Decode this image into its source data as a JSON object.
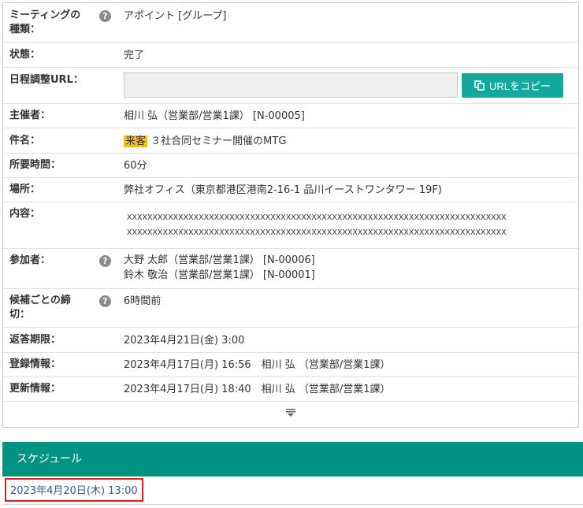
{
  "meeting": {
    "rows": [
      {
        "label_line1": "ミーティングの",
        "label_line2": "種類：",
        "value": "アポイント [グループ]"
      },
      {
        "label": "状態：",
        "value": "完了"
      },
      {
        "label": "日程調整URL：",
        "url_value": "",
        "copy_button": "URLをコピー"
      },
      {
        "label": "主催者：",
        "value": "相川 弘（営業部/営業1課） [N-00005]"
      },
      {
        "label": "件名：",
        "tag": "来客",
        "value": "３社合同セミナー開催のMTG"
      },
      {
        "label": "所要時間：",
        "value": "60分"
      },
      {
        "label": "場所：",
        "value": "弊社オフィス（東京都港区港南2-16-1 品川イーストワンタワー 19F)"
      },
      {
        "label": "内容：",
        "value_line1": "XXXXXXXXXXXXXXXXXXXXXXXXXXXXXXXXXXXXXXXXXXXXXXXXXXXXXXXXXXXXXXXXXXXXXXXXXX",
        "value_line2": "XXXXXXXXXXXXXXXXXXXXXXXXXXXXXXXXXXXXXXXXXXXXXXXXXXXXXXXXXXXXXXXXXXXXXXXXXX"
      },
      {
        "label": "参加者：",
        "value_line1": "大野 太郎（営業部/営業1課） [N-00006]",
        "value_line2": "鈴木 敬治（営業部/営業1課） [N-00001]"
      },
      {
        "label_line1": "候補ごとの締",
        "label_line2": "切：",
        "value": "6時間前"
      },
      {
        "label": "返答期限：",
        "value": "2023年4月21日(金) 3:00"
      },
      {
        "label": "登録情報：",
        "value": "2023年4月17日(月) 16:56　相川 弘 （営業部/営業1課）"
      },
      {
        "label": "更新情報：",
        "value": "2023年4月17日(月) 18:40　相川 弘 （営業部/営業1課）"
      }
    ],
    "help_glyph": "?"
  },
  "schedule": {
    "title": "スケジュール",
    "entry": "2023年4月20日(木) 13:00"
  },
  "colors": {
    "accent": "#13a89e",
    "header": "#009384",
    "tag": "#f7c31b",
    "link": "#2f5c9c",
    "highlight": "#d92020"
  },
  "icons": {
    "copy": "copy-icon",
    "help": "help-icon",
    "expand": "expand-down-icon"
  }
}
